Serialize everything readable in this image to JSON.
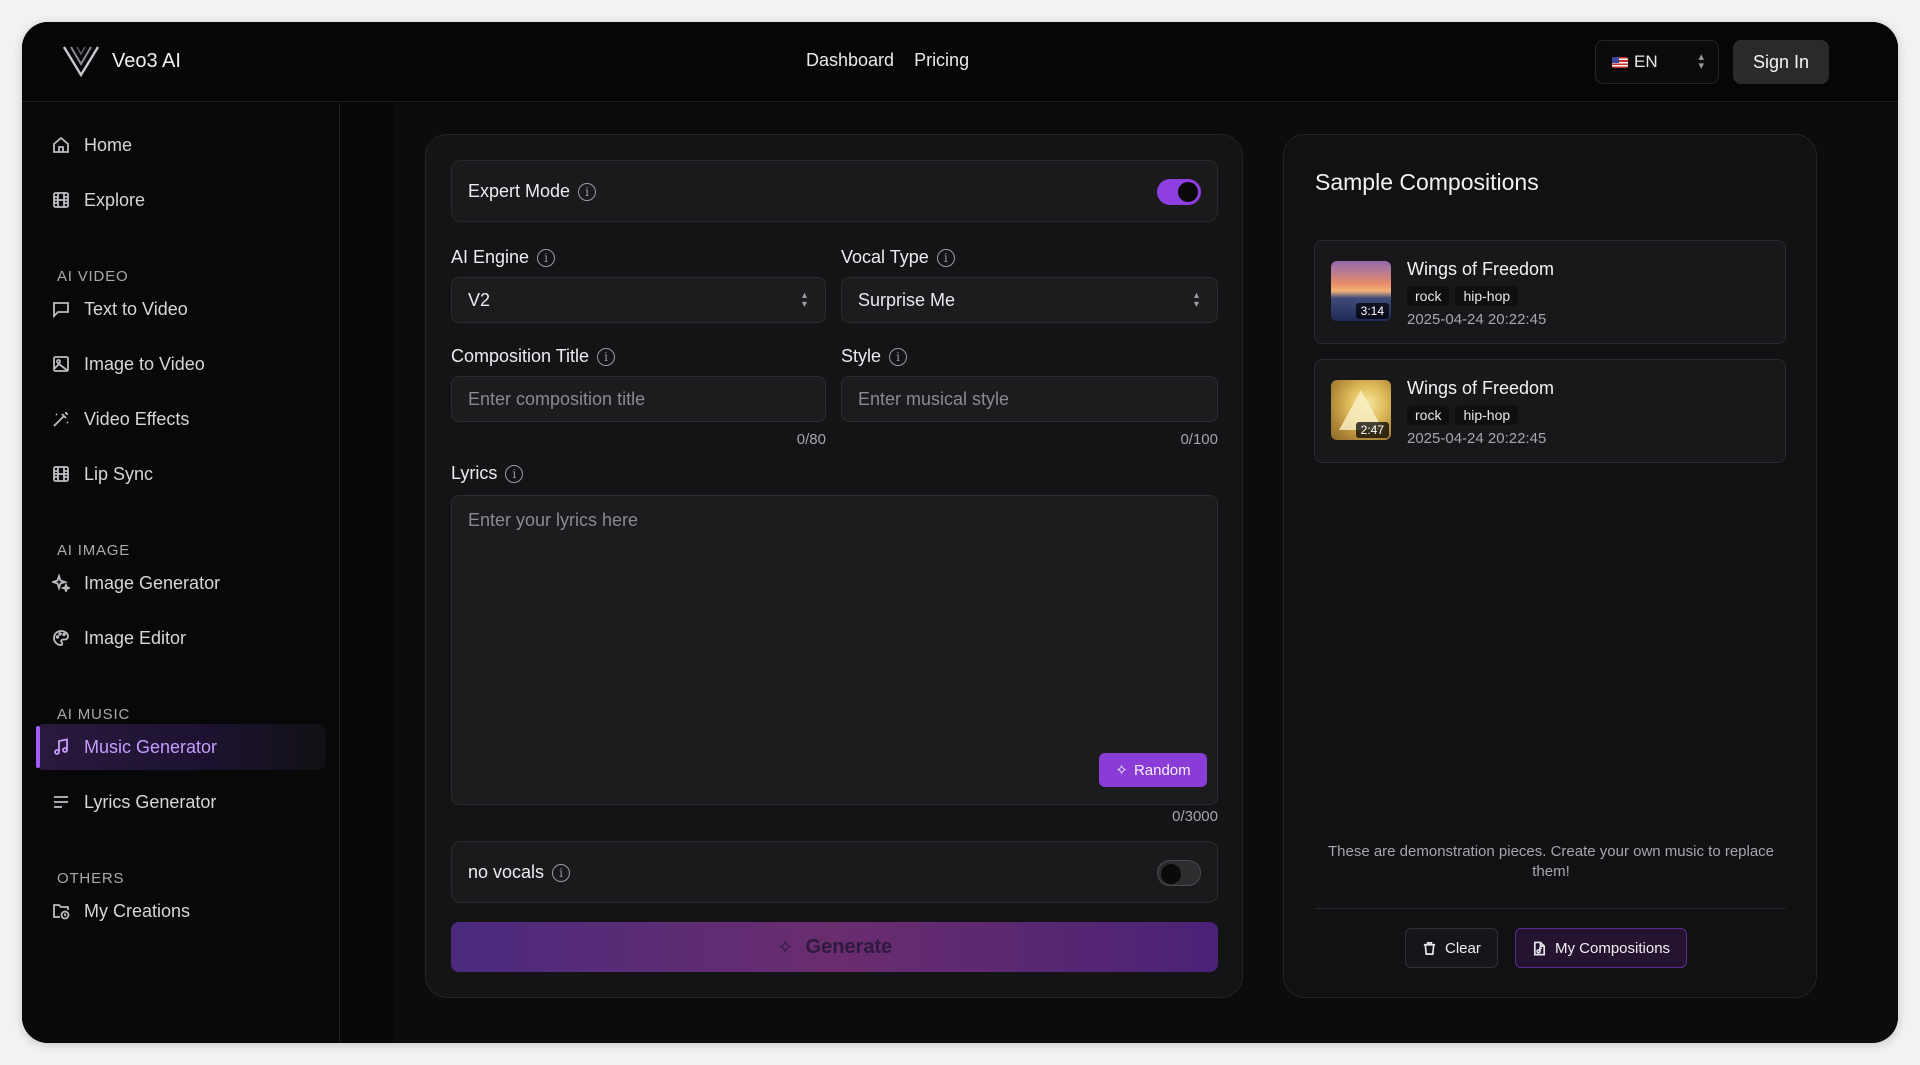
{
  "app": {
    "name": "Veo3 AI"
  },
  "topnav": {
    "items": [
      "Dashboard",
      "Pricing"
    ],
    "language": "EN",
    "sign_in": "Sign In"
  },
  "sidebar": {
    "home": "Home",
    "explore": "Explore",
    "sections": {
      "ai_video": "AI VIDEO",
      "ai_image": "AI IMAGE",
      "ai_music": "AI MUSIC",
      "others": "OTHERS"
    },
    "video_items": [
      "Text to Video",
      "Image to Video",
      "Video Effects",
      "Lip Sync"
    ],
    "image_items": [
      "Image Generator",
      "Image Editor"
    ],
    "music_items": [
      "Music Generator",
      "Lyrics Generator"
    ],
    "other_items": [
      "My Creations"
    ],
    "active_item": "Music Generator"
  },
  "form": {
    "expert_mode": {
      "label": "Expert Mode",
      "enabled": true
    },
    "ai_engine": {
      "label": "AI Engine",
      "value": "V2"
    },
    "vocal_type": {
      "label": "Vocal Type",
      "value": "Surprise Me"
    },
    "composition_title": {
      "label": "Composition Title",
      "placeholder": "Enter composition title",
      "counter": "0/80"
    },
    "style": {
      "label": "Style",
      "placeholder": "Enter musical style",
      "counter": "0/100"
    },
    "lyrics": {
      "label": "Lyrics",
      "placeholder": "Enter your lyrics here",
      "counter": "0/3000",
      "random_label": "Random"
    },
    "no_vocals": {
      "label": "no vocals",
      "enabled": false
    },
    "generate_label": "Generate"
  },
  "samples": {
    "title": "Sample Compositions",
    "items": [
      {
        "title": "Wings of Freedom",
        "tags": [
          "rock",
          "hip-hop"
        ],
        "date": "2025-04-24 20:22:45",
        "duration": "3:14"
      },
      {
        "title": "Wings of Freedom",
        "tags": [
          "rock",
          "hip-hop"
        ],
        "date": "2025-04-24 20:22:45",
        "duration": "2:47"
      }
    ],
    "note": "These are demonstration pieces. Create your own music to replace them!",
    "clear_label": "Clear",
    "my_compositions_label": "My Compositions"
  },
  "colors": {
    "accent": "#8d3fe0",
    "active_nav_text": "#c79cff",
    "background": "#070707"
  }
}
